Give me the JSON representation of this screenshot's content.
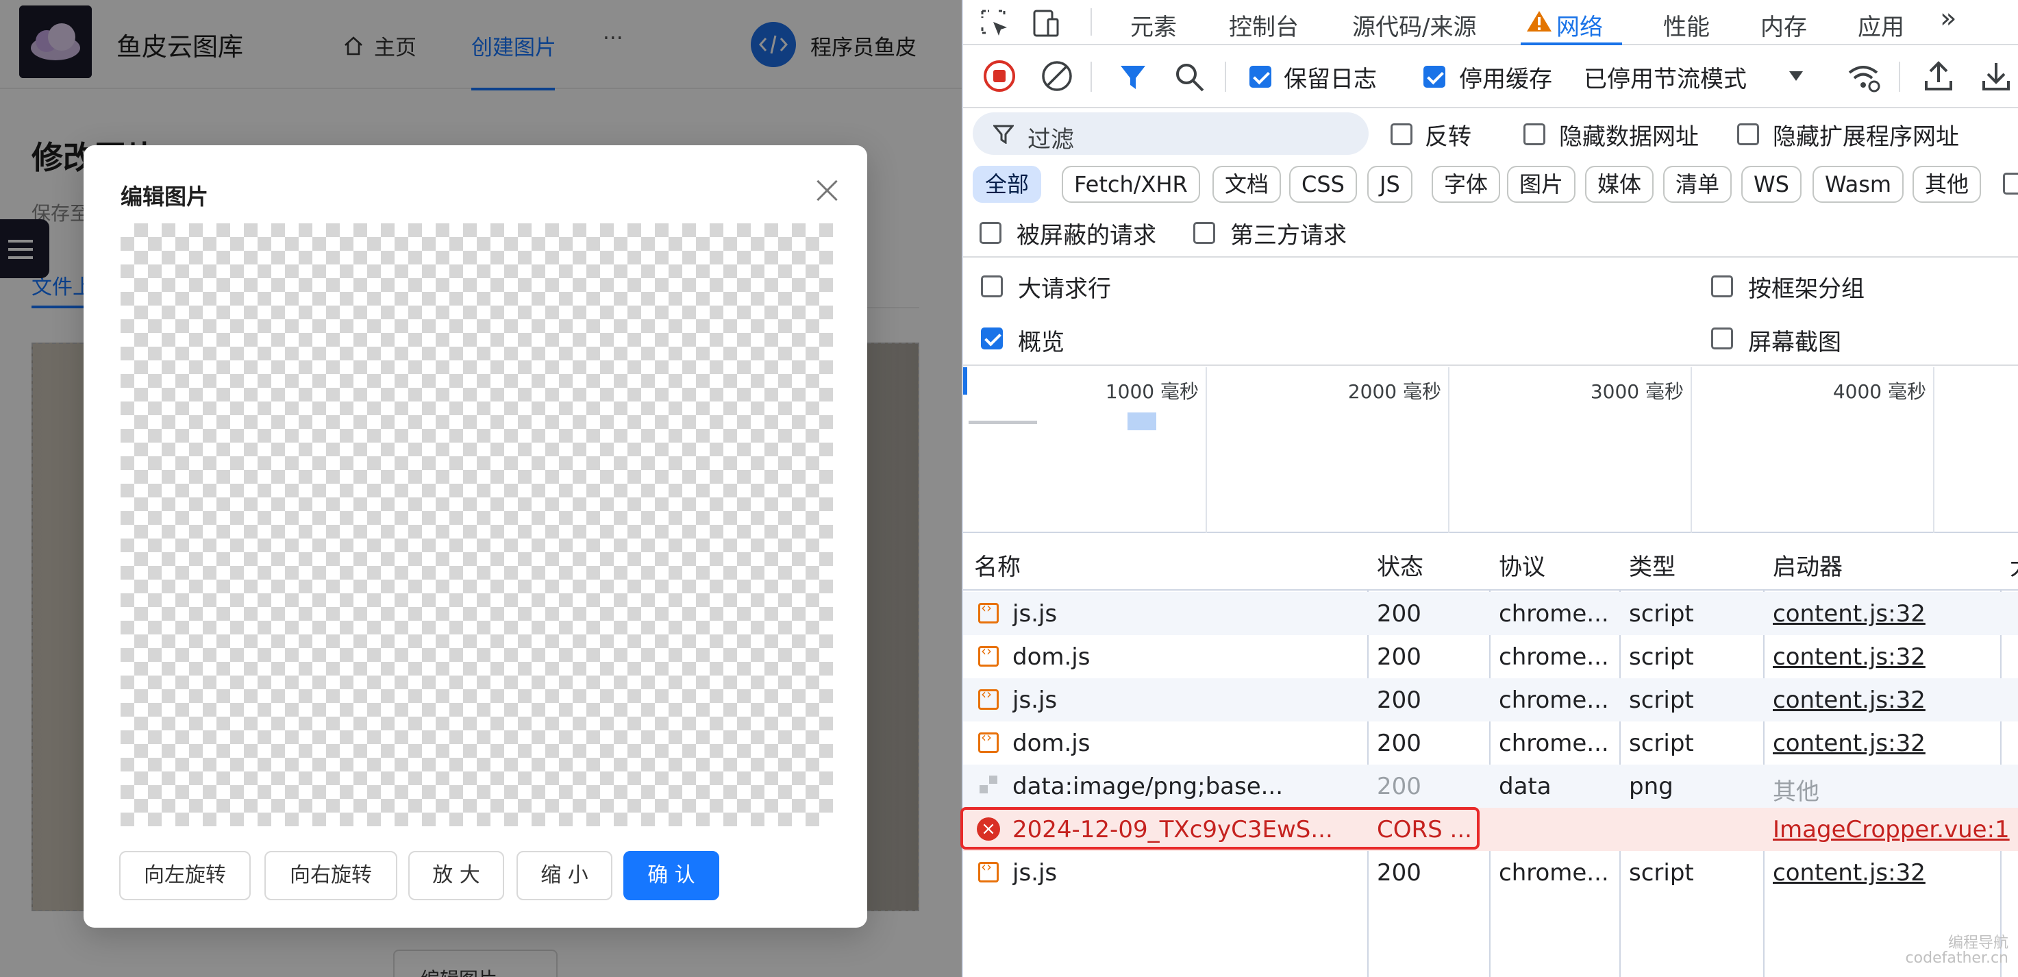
{
  "app": {
    "site_title": "鱼皮云图库",
    "nav": {
      "home": "主页",
      "create": "创建图片",
      "more": "···"
    },
    "username": "程序员鱼皮",
    "page_title": "修改图片",
    "save_hint": "保存至",
    "tab_label": "文件上",
    "edit_button": "编辑图片"
  },
  "modal": {
    "title": "编辑图片",
    "buttons": {
      "rotate_left": "向左旋转",
      "rotate_right": "向右旋转",
      "zoom_in": "放 大",
      "zoom_out": "缩 小",
      "confirm": "确 认"
    }
  },
  "devtools": {
    "tabs": [
      "元素",
      "控制台",
      "源代码/来源",
      "网络",
      "性能",
      "内存",
      "应用"
    ],
    "active_tab": "网络",
    "more_tabs": "»",
    "toolbar": {
      "preserve_log": "保留日志",
      "disable_cache": "停用缓存",
      "throttle": "已停用节流模式"
    },
    "filter": {
      "placeholder": "过滤",
      "invert": "反转",
      "hide_data_urls": "隐藏数据网址",
      "hide_ext_urls": "隐藏扩展程序网址"
    },
    "types": [
      "全部",
      "Fetch/XHR",
      "文档",
      "CSS",
      "JS",
      "字体",
      "图片",
      "媒体",
      "清单",
      "WS",
      "Wasm",
      "其他"
    ],
    "blocked": {
      "blocked_requests": "被屏蔽的请求",
      "third_party": "第三方请求"
    },
    "options": {
      "big_rows": "大请求行",
      "group_by_frame": "按框架分组",
      "overview": "概览",
      "screenshots": "屏幕截图"
    },
    "ticks": [
      "1000 毫秒",
      "2000 毫秒",
      "3000 毫秒",
      "4000 毫秒"
    ],
    "columns": {
      "name": "名称",
      "status": "状态",
      "protocol": "协议",
      "type": "类型",
      "initiator": "启动器",
      "size": "大"
    },
    "rows": [
      {
        "name": "js.js",
        "status": "200",
        "protocol": "chrome...",
        "type": "script",
        "initiator": "content.js:32",
        "kind": "script"
      },
      {
        "name": "dom.js",
        "status": "200",
        "protocol": "chrome...",
        "type": "script",
        "initiator": "content.js:32",
        "kind": "script"
      },
      {
        "name": "js.js",
        "status": "200",
        "protocol": "chrome...",
        "type": "script",
        "initiator": "content.js:32",
        "kind": "script"
      },
      {
        "name": "dom.js",
        "status": "200",
        "protocol": "chrome...",
        "type": "script",
        "initiator": "content.js:32",
        "kind": "script"
      },
      {
        "name": "data:image/png;base...",
        "status": "200",
        "protocol": "data",
        "type": "png",
        "initiator": "其他",
        "kind": "data"
      },
      {
        "name": "2024-12-09_TXc9yC3EwS...",
        "status": "CORS ...",
        "protocol": "",
        "type": "",
        "initiator": "ImageCropper.vue:1",
        "kind": "error"
      },
      {
        "name": "js.js",
        "status": "200",
        "protocol": "chrome...",
        "type": "script",
        "initiator": "content.js:32",
        "kind": "script"
      }
    ]
  },
  "watermark": {
    "line1": "编程导航",
    "line2": "codefather.cn"
  },
  "colors": {
    "accent": "#1677ff",
    "devtools_accent": "#1a73e8",
    "error_bg": "#fce8e6",
    "error_border": "#e82a2a"
  }
}
